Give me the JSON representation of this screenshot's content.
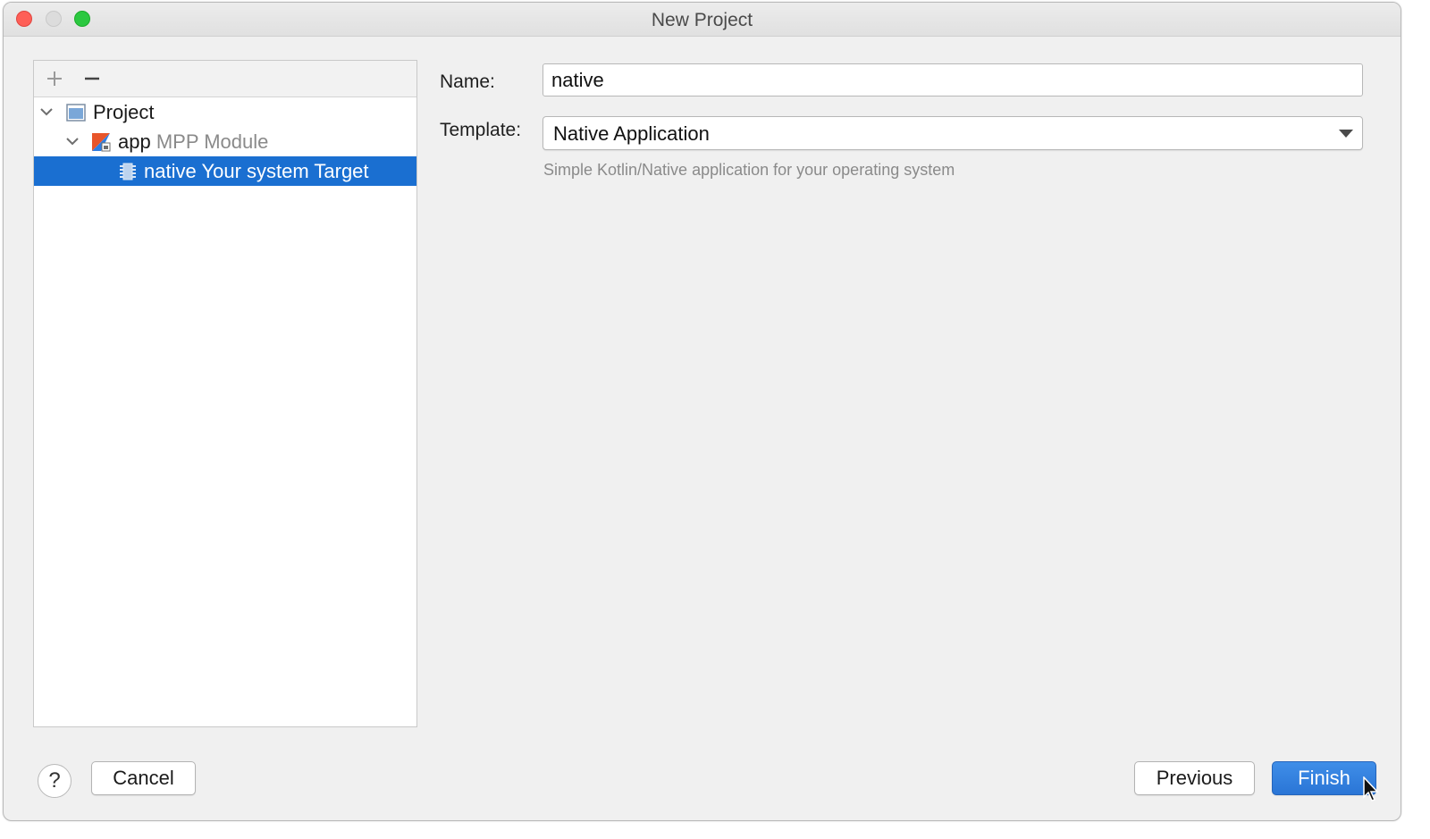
{
  "window": {
    "title": "New Project"
  },
  "tree": {
    "toolbar": {
      "add_icon": "plus-icon",
      "remove_icon": "minus-icon"
    },
    "nodes": [
      {
        "label": "Project",
        "suffix": "",
        "icon": "project-icon",
        "expanded": true
      },
      {
        "label": "app",
        "suffix": "MPP Module",
        "icon": "kotlin-module-icon",
        "expanded": true
      },
      {
        "label": "native",
        "suffix": "Your system Target",
        "icon": "chip-icon",
        "selected": true
      }
    ]
  },
  "form": {
    "name_label": "Name:",
    "name_value": "native",
    "template_label": "Template:",
    "template_value": "Native Application",
    "template_hint": "Simple Kotlin/Native application for your operating system"
  },
  "buttons": {
    "help": "?",
    "cancel": "Cancel",
    "previous": "Previous",
    "finish": "Finish"
  },
  "colors": {
    "selection": "#1a6fd1",
    "primary_button": "#2a75d6"
  }
}
